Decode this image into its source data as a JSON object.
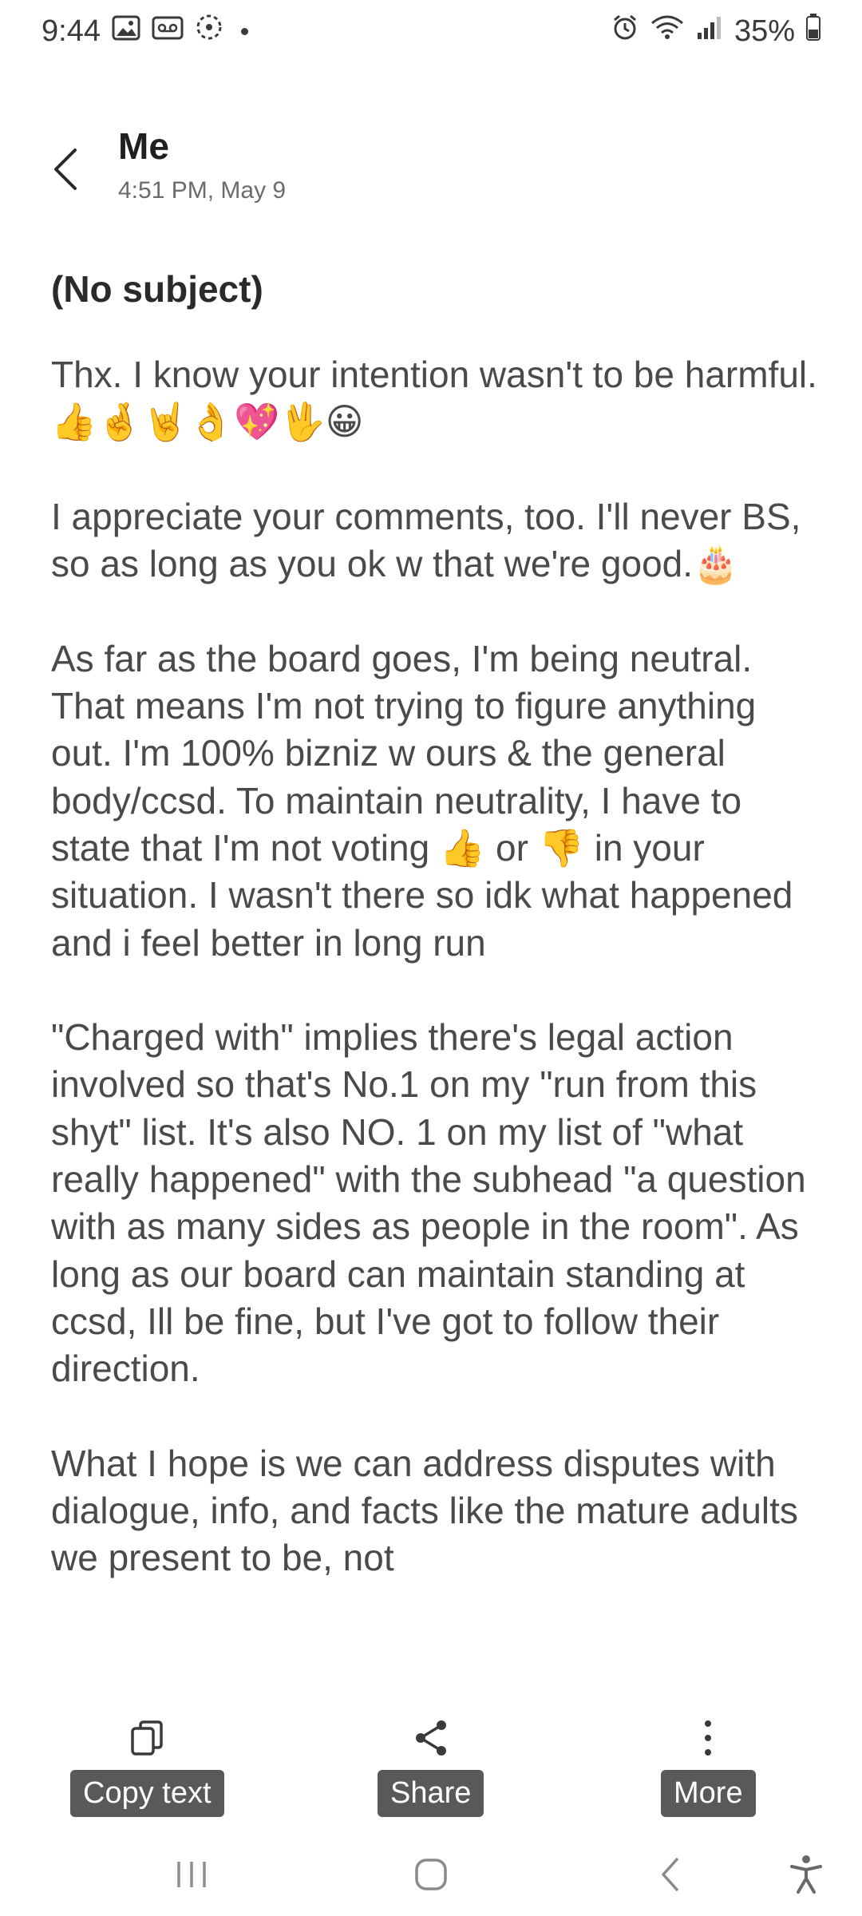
{
  "status_bar": {
    "time": "9:44",
    "left_icons": [
      "gallery-icon",
      "voicemail-icon",
      "sync-icon",
      "notification-dot"
    ],
    "right_icons": [
      "alarm-icon",
      "wifi-icon",
      "signal-icon"
    ],
    "battery": "35%"
  },
  "header": {
    "sender": "Me",
    "datetime": "4:51 PM, May 9"
  },
  "message": {
    "subject": "(No subject)",
    "paragraphs": [
      "Thx. I know your intention wasn't to be harmful.👍🤞🤘👌💖🖖😀",
      "I appreciate your comments, too. I'll never BS, so as long as you ok w that we're good.🎂",
      "As far as the board goes, I'm being neutral. That means I'm not trying to figure anything out. I'm 100% bizniz w ours & the general body/ccsd. To maintain neutrality, I have to state that I'm not voting 👍 or 👎 in your situation. I wasn't there so idk what happened and i feel better in long run",
      "\"Charged with\" implies there's legal action involved so that's No.1 on my \"run from this shyt\" list. It's also NO. 1 on my list of \"what really happened\" with the subhead \"a question with as many sides as people in the room\". As long as our board can maintain standing at ccsd, Ill be fine, but I've got to follow their direction.",
      "What I hope is we can address disputes with dialogue, info, and facts like the mature adults we present to be, not"
    ]
  },
  "actions": {
    "copy_label": "Copy text",
    "share_label": "Share",
    "more_label": "More"
  },
  "nav": [
    "recents-button",
    "home-button",
    "back-button",
    "accessibility-button"
  ]
}
